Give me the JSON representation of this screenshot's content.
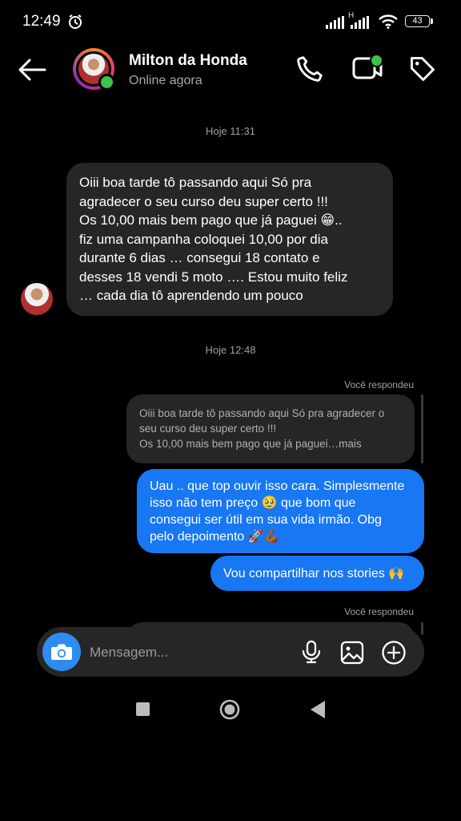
{
  "status_bar": {
    "time": "12:49",
    "network_label": "H",
    "battery": "43"
  },
  "header": {
    "contact_name": "Milton da Honda",
    "contact_status": "Online agora"
  },
  "messages": {
    "timestamp_1": "Hoje 11:31",
    "received_lines": [
      "Oiii boa tarde tô passando aqui Só pra",
      "agradecer o seu curso deu super certo !!!",
      "Os 10,00 mais bem pago que já paguei 😁..",
      "fiz uma campanha coloquei 10,00 por dia",
      "durante 6 dias … consegui 18 contato e",
      "desses 18 vendi 5 moto …. Estou muito feliz",
      "… cada dia tô aprendendo um pouco"
    ],
    "timestamp_2": "Hoje 12:48",
    "replied_label": "Você respondeu",
    "quote_lines": [
      "Oiii boa tarde tô passando aqui Só pra agradecer o",
      "seu curso deu super certo !!!",
      "Os 10,00 mais bem pago que já paguei…mais"
    ],
    "sent_1_lines": [
      "Uau .. que top ouvir isso cara. Simplesmente",
      "isso não tem preço 🥹 que bom que",
      "consegui ser útil em sua vida irmão. Obg",
      "pelo depoimento 🚀💪🏾"
    ],
    "sent_2": "Vou compartilhar nos stories 🙌",
    "replied_label_2": "Você respondeu"
  },
  "composer": {
    "placeholder": "Mensagem..."
  },
  "colors": {
    "accent_blue": "#1877f2",
    "online_green": "#3dc24c",
    "bubble_gray": "#262626"
  }
}
